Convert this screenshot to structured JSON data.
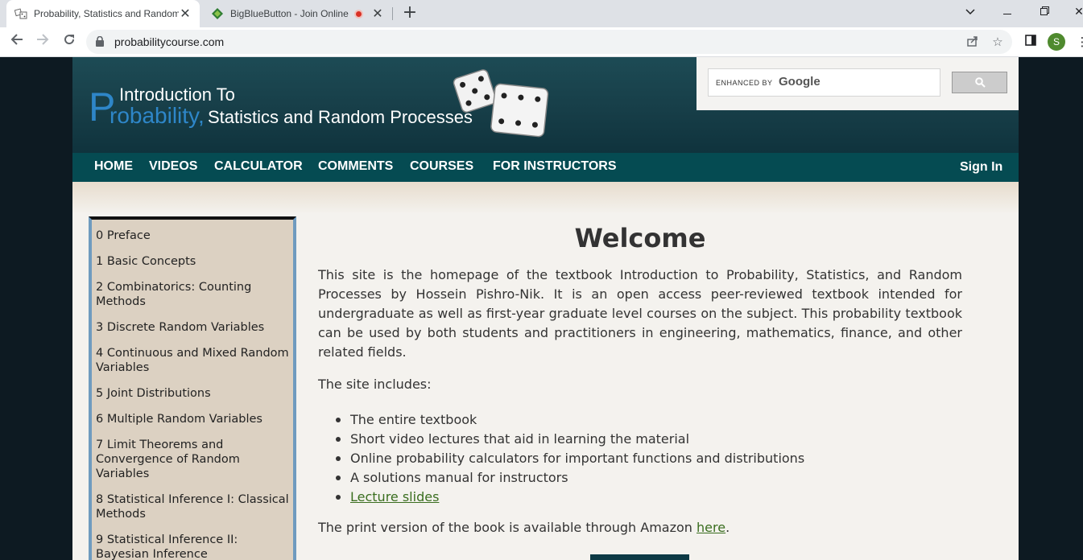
{
  "browser": {
    "tabs": [
      {
        "title": "Probability, Statistics and Random",
        "active": true
      },
      {
        "title": "BigBlueButton - Join Online",
        "active": false,
        "recording": true
      }
    ],
    "url": "probabilitycourse.com",
    "profile_initial": "S"
  },
  "site": {
    "logo": {
      "line1": "Introduction To",
      "big_letter": "P",
      "line2_blue": "robability,",
      "line2_white": "Statistics and Random Processes"
    },
    "search": {
      "enhanced_by": "ENHANCED BY",
      "google": "Google"
    },
    "nav": [
      "HOME",
      "VIDEOS",
      "CALCULATOR",
      "COMMENTS",
      "COURSES",
      "FOR INSTRUCTORS"
    ],
    "sign_in": "Sign In"
  },
  "sidebar": {
    "items": [
      "0 Preface",
      "1 Basic Concepts",
      "2 Combinatorics: Counting Methods",
      "3 Discrete Random Variables",
      "4 Continuous and Mixed Random Variables",
      "5 Joint Distributions",
      "6 Multiple Random Variables",
      "7 Limit Theorems and Convergence of Random Variables",
      "8 Statistical Inference I: Classical Methods",
      "9 Statistical Inference II: Bayesian Inference"
    ]
  },
  "main": {
    "heading": "Welcome",
    "intro": "This site is the homepage of the textbook Introduction to Probability, Statistics, and Random Processes by Hossein Pishro-Nik. It is an open access peer-reviewed textbook intended for undergraduate as well as first-year graduate level courses on the subject. This probability textbook can be used by both students and practitioners in engineering, mathematics, finance, and other related fields.",
    "includes_label": "The site includes:",
    "includes": [
      "The entire textbook",
      "Short video lectures that aid in learning the material",
      "Online probability calculators for important functions and distributions",
      "A solutions manual for instructors"
    ],
    "lecture_slides": "Lecture slides",
    "print_text": "The print version of the book is available through Amazon",
    "print_link": "here",
    "print_end": "."
  }
}
